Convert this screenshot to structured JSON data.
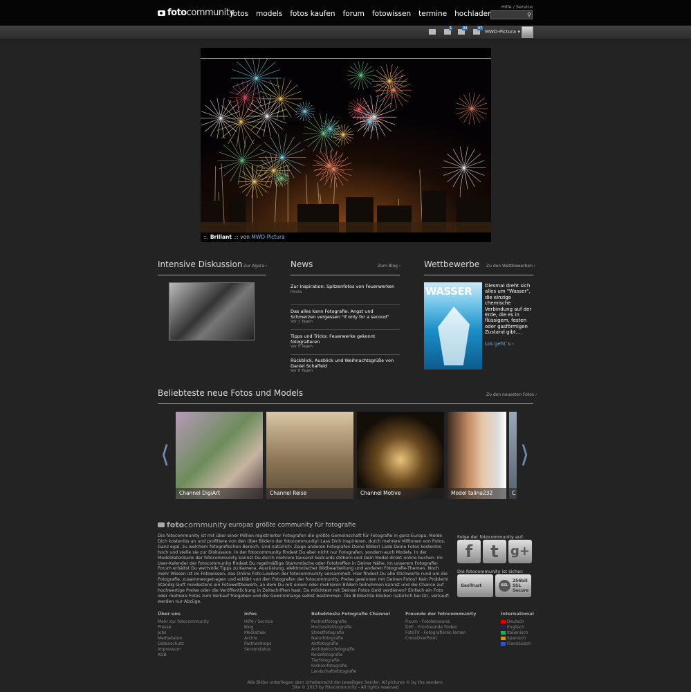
{
  "header": {
    "logo_bold": "foto",
    "logo_light": "community",
    "nav": [
      "fotos",
      "models",
      "fotos kaufen",
      "forum",
      "fotowissen",
      "termine",
      "hochladen"
    ],
    "help_link": "Hilfe / Service"
  },
  "userbar": {
    "badges": [
      "1",
      "90",
      "97"
    ],
    "username": "MWD-Pictura"
  },
  "hero": {
    "caption_prefix": "::.",
    "caption_title": "Brillant",
    "caption_mid": ".:: von",
    "caption_author": "MWD-Pictura"
  },
  "sections": {
    "diskussion": {
      "title": "Intensive Diskussion",
      "link": "Zur Agora"
    },
    "news": {
      "title": "News",
      "link": "Zum Blog",
      "items": [
        {
          "title": "Zur Inspiration: Spitzenfotos von Feuerwerken",
          "date": "Heute"
        },
        {
          "title": "Das alles kann Fotografie: Angst und Schmerzen vergessen \"If only for a second\"",
          "date": "Vor 1 Tagen"
        },
        {
          "title": "Tipps und Tricks: Feuerwerke gekonnt fotografieren",
          "date": "Vor 5 Tagen"
        },
        {
          "title": "Rückblick, Ausblick und Weihnachtsgrüße von Daniel Schaffeld",
          "date": "Vor 8 Tagen"
        }
      ]
    },
    "wettbewerbe": {
      "title": "Wettbewerbe",
      "link": "Zu den Wettbewerben",
      "image_word": "WASSER",
      "text": "Diesmal dreht sich alles um \"Wasser\", die einzige chemische Verbindung auf der Erde, die es in flüssigem, festen oder gasförmigen Zustand gibt....",
      "cta": "Los geht`s"
    },
    "popular": {
      "title": "Beliebteste neue Fotos und Models",
      "link": "Zu den neuesten Fotos",
      "tiles": [
        "Channel DigiArt",
        "Channel Reise",
        "Channel Motive",
        "Model talina232",
        "C"
      ]
    }
  },
  "footer": {
    "logo_bold": "foto",
    "logo_light": "community",
    "tagline": "europas größte community für fotografie",
    "about": "Die fotocommunity ist mit über einer Million registrierter Fotografen die größte Gemeinschaft für Fotografie in ganz Europa. Melde Dich kostenlos an und profitiere von den über Bildern der fotocommunity! Lass Dich inspirieren, durch mehrere Millionen von Fotos. Ganz egal, zu welchem fotografischen Bereich. Und natürlich: Zeige anderen Fotografen Deine Bilder! Lade Deine Fotos kostenlos hoch und stelle sie zur Diskussion. In der fotocommunity findest Du aber nicht nur Fotografen, sondern auch Models. In der Modeldatenbank der fotocommunity kannst Du durch mehrere tausend Sedcards stöbern und Dein Model direkt online buchen. Im User-Kalender der fotocommunity findest Du regelmäßige Stammtische oder Fototreffen in Deiner Nähe. Im unserem Fotografie-Forum erhältst Du wertvolle Tipps zu Kamera, Ausrüstung, elektronischer Bildbearbeitung und anderen Fotografie-Themen. Noch mehr Wissen ist im Fotowissen, das Online Foto-Lexikon der fotocommunity versammelt. Hier findest Du alle Stichworte rund um die Fotografie, zusammengetragen und erklärt von den Fotografen der fotocommunity. Preise gewinnen mit Deinen Fotos? Kein Problem! Ständig läuft mindestens ein Fotowettbewerb, an dem Du mit einem oder mehreren Bildern teilnehmen kannst und die Chance auf hochwertige Preise oder die Veröffentlichung in Zeitschriften hast.  Du möchtest mit Deinen Fotos Geld verdienen? Einfach ein Foto oder mehrere Fotos zum Verkauf freigeben und die Gewinnmarge selbst bestimmen. Die Bildrechte bleiben natürlich bei Dir, verkauft werden nur Abzüge.",
    "follow_label": "Folge der fotocommunity auf:",
    "social": [
      "f",
      "t",
      "g+"
    ],
    "secure_label": "Die fotocommunity ist sicher:",
    "cert1": "GeoTrust",
    "cert2_lines": [
      "256bit",
      "SSL",
      "Secure"
    ],
    "cert2_badge": "SSL",
    "columns": [
      {
        "heading": "Über uns",
        "items": [
          "Mehr zur fotocommunity",
          "Presse",
          "Jobs",
          "Mediadaten",
          "Datenschutz",
          "Impressum",
          "AGB"
        ]
      },
      {
        "heading": "Infos",
        "items": [
          "Hilfe / Service",
          "Blog",
          "Mediathek",
          "Archiv",
          "Partnershops",
          "Serverstatus"
        ]
      },
      {
        "heading": "Beliebteste Fotografie Channel",
        "items": [
          "Portraitfotografie",
          "Hochzeitsfotografie",
          "Streetfotografie",
          "Naturfotografie",
          "Aktfotografie",
          "Architekturfotografie",
          "Reisefotografie",
          "Tierfotografie",
          "Fashionfotografie",
          "Landschaftsfotografie"
        ]
      },
      {
        "heading": "Freunde der fotocommunity",
        "items": [
          "Fixum - Fotoleinwand",
          "DVF - Fotofreunde finden",
          "FotoTV - Fotografieren lernen",
          "CrossOverPoint"
        ]
      },
      {
        "heading": "International",
        "items": [
          "Deutsch",
          "Englisch",
          "Italienisch",
          "Spanisch",
          "Französisch"
        ]
      }
    ],
    "flag_colors": [
      "#d00",
      "#224",
      "#2a6",
      "#c90",
      "#35c"
    ],
    "copyright_1": "Alle Bilder unterliegen dem Urheberrecht der jeweiligen Sender. All pictures © by the senders.",
    "copyright_2": "Site © 2013 by fotocommunity - All rights reserved"
  }
}
